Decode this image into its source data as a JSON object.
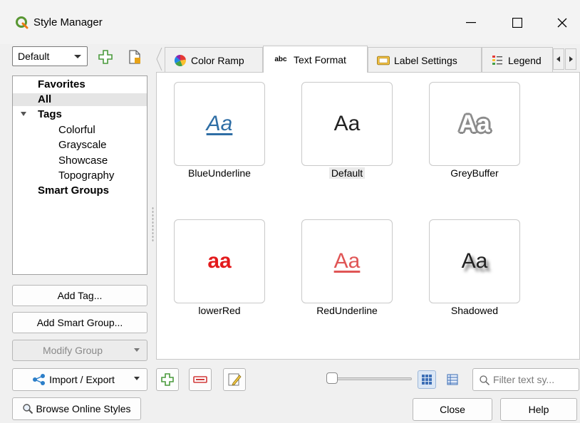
{
  "window": {
    "title": "Style Manager",
    "icons": {
      "app": "qgis-logo-icon",
      "minimize": "minimize-icon",
      "maximize": "maximize-icon",
      "close": "close-icon"
    }
  },
  "library": {
    "selected": "Default",
    "icons": [
      "add-library-icon",
      "new-library-icon"
    ]
  },
  "tree": {
    "favorites": "Favorites",
    "all": "All",
    "tags": "Tags",
    "tag_items": [
      "Colorful",
      "Grayscale",
      "Showcase",
      "Topography"
    ],
    "smart_groups": "Smart Groups"
  },
  "left_buttons": {
    "add_tag": "Add Tag...",
    "add_smart_group": "Add Smart Group...",
    "modify_group": "Modify Group",
    "import_export": "Import / Export",
    "browse_online": "Browse Online Styles"
  },
  "tabs": [
    {
      "label": "Color Ramp",
      "icon": "color-ramp-icon",
      "active": false
    },
    {
      "label": "Text Format",
      "icon": "text-format-icon",
      "active": true
    },
    {
      "label": "Label Settings",
      "icon": "label-settings-icon",
      "active": false
    },
    {
      "label": "Legend",
      "icon": "legend-icon",
      "active": false
    }
  ],
  "styles": [
    {
      "name": "BlueUnderline",
      "preview": "Aa",
      "color": "#2f6ea5",
      "selected": false
    },
    {
      "name": "Default",
      "preview": "Aa",
      "color": "#222222",
      "selected": true
    },
    {
      "name": "GreyBuffer",
      "preview": "Aa",
      "color": "#ffffff",
      "selected": false
    },
    {
      "name": "lowerRed",
      "preview": "aa",
      "color": "#e31a1c",
      "selected": false
    },
    {
      "name": "RedUnderline",
      "preview": "Aa",
      "color": "#e05555",
      "selected": false
    },
    {
      "name": "Shadowed",
      "preview": "Aa",
      "color": "#222222",
      "selected": false
    }
  ],
  "bottom": {
    "filter_placeholder": "Filter text sy...",
    "close": "Close",
    "help": "Help",
    "icons": [
      "add-item-icon",
      "remove-item-icon",
      "edit-item-icon",
      "icon-view-icon",
      "list-view-icon",
      "search-icon"
    ]
  },
  "colors": {
    "accent_green": "#4caf50",
    "remove_red": "#e04545"
  }
}
